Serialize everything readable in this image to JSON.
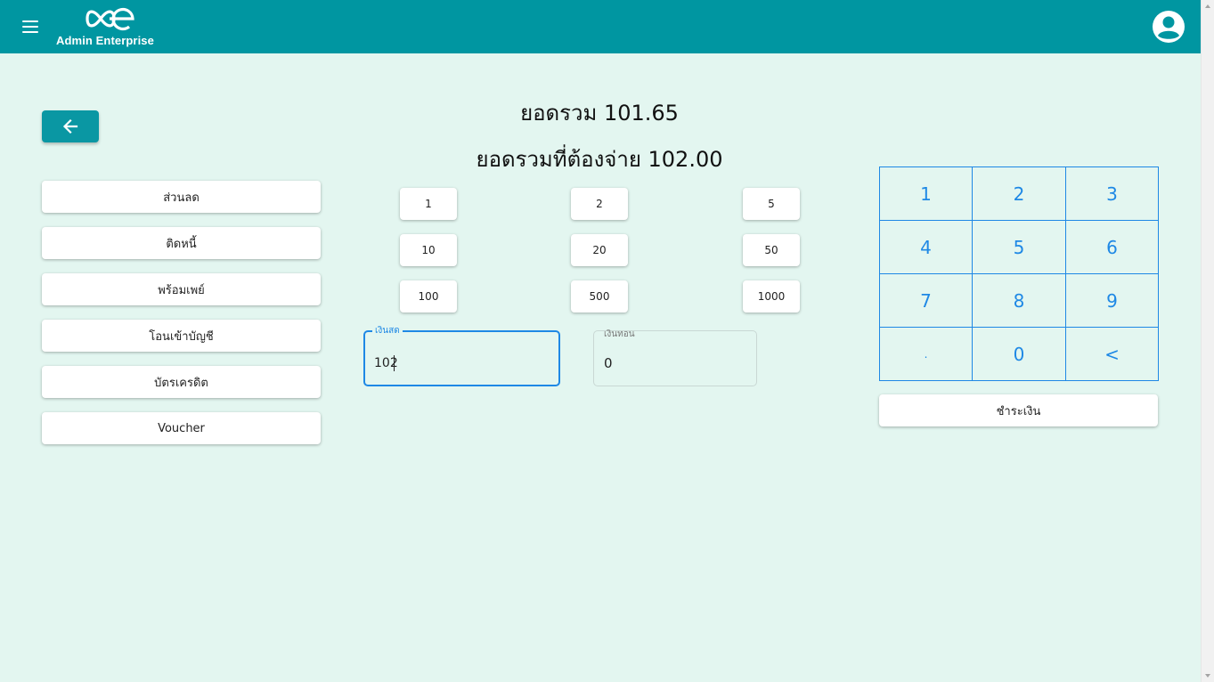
{
  "header": {
    "brand": "Admin Enterprise",
    "menu_icon": "hamburger-icon",
    "logo_icon": "infinity-e-logo",
    "account_icon": "account-circle-icon"
  },
  "back_icon": "arrow-left-icon",
  "payment_methods": [
    "ส่วนลด",
    "ติดหนี้",
    "พร้อมเพย์",
    "โอนเข้าบัญชี",
    "บัตรเครดิต",
    "Voucher"
  ],
  "totals": {
    "total": "ยอดรวม 101.65",
    "total_to_pay": "ยอดรวมที่ต้องจ่าย 102.00"
  },
  "cash_denominations": [
    "1",
    "2",
    "5",
    "10",
    "20",
    "50",
    "100",
    "500",
    "1000"
  ],
  "cash_field": {
    "label": "เงินสด",
    "value": "102"
  },
  "change_field": {
    "label": "เงินทอน",
    "value": "0"
  },
  "keypad": [
    "1",
    "2",
    "3",
    "4",
    "5",
    "6",
    "7",
    "8",
    "9",
    ".",
    "0",
    "<"
  ],
  "pay_button": "ชำระเงิน",
  "colors": {
    "header": "#0096a1",
    "background": "#e3f6f0",
    "accent": "#1e88e5",
    "back_button": "#0a97a3"
  }
}
